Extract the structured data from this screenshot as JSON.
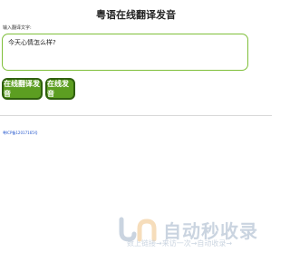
{
  "page": {
    "title": "粤语在线翻译发音"
  },
  "form": {
    "input_label": "输入翻译文字:",
    "input_value": "今天心情怎么样?"
  },
  "buttons": {
    "translate_label": "在线翻译发音",
    "speak_label": "在线发音"
  },
  "footer": {
    "link_text": "粤ICP备12017165号"
  },
  "watermark": {
    "title": "自动秒收录",
    "subtitle": "数上链接→来访一次→自动收录→"
  },
  "colors": {
    "accent": "#5c9e21",
    "accent_border": "#2f5f0e",
    "input_border": "#7fbf3a",
    "link": "#2255cc"
  }
}
